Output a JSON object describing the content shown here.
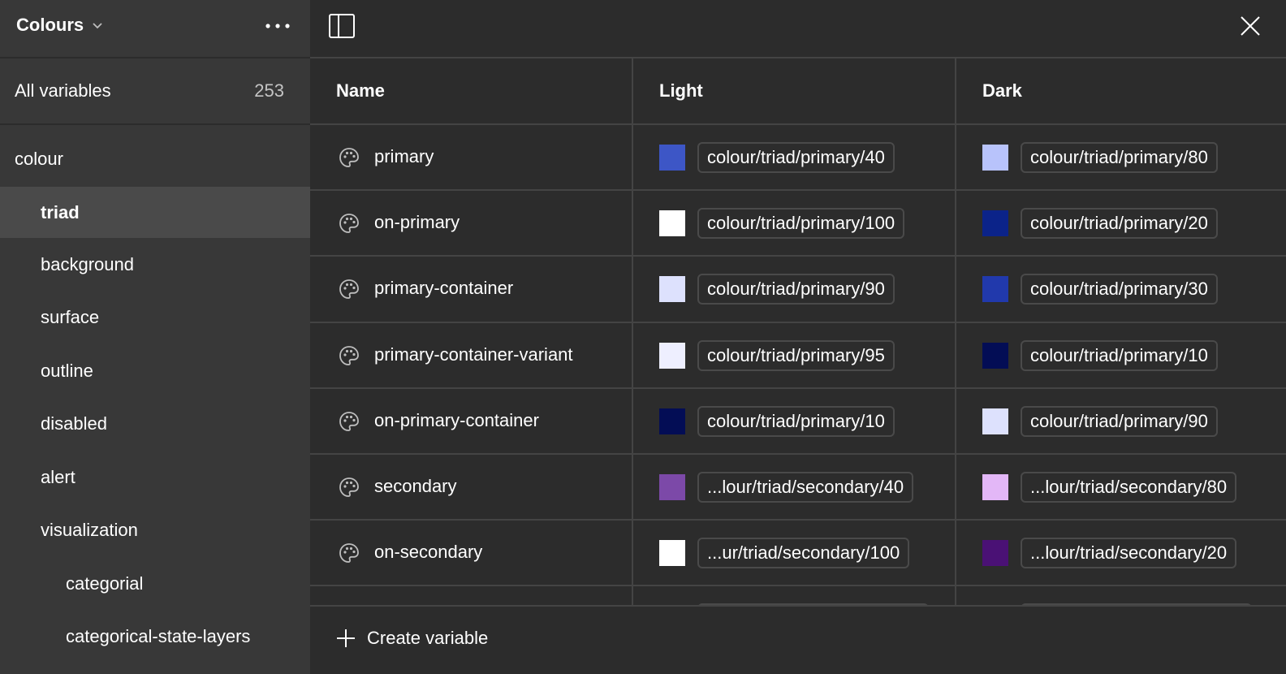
{
  "sidebar": {
    "collection_title": "Colours",
    "all_variables_label": "All variables",
    "all_variables_count": "253",
    "groups": [
      {
        "label": "colour",
        "level": 0,
        "active": false
      },
      {
        "label": "triad",
        "level": 1,
        "active": true
      },
      {
        "label": "background",
        "level": 1,
        "active": false
      },
      {
        "label": "surface",
        "level": 1,
        "active": false
      },
      {
        "label": "outline",
        "level": 1,
        "active": false
      },
      {
        "label": "disabled",
        "level": 1,
        "active": false
      },
      {
        "label": "alert",
        "level": 1,
        "active": false
      },
      {
        "label": "visualization",
        "level": 1,
        "active": false
      },
      {
        "label": "categorial",
        "level": 2,
        "active": false
      },
      {
        "label": "categorical-state-layers",
        "level": 2,
        "active": false
      }
    ]
  },
  "table": {
    "columns": [
      "Name",
      "Light",
      "Dark"
    ],
    "rows": [
      {
        "name": "primary",
        "light": {
          "swatch": "#3d56c6",
          "value": "colour/triad/primary/40"
        },
        "dark": {
          "swatch": "#b8c3fb",
          "value": "colour/triad/primary/80"
        }
      },
      {
        "name": "on-primary",
        "light": {
          "swatch": "#ffffff",
          "value": "colour/triad/primary/100"
        },
        "dark": {
          "swatch": "#0b2389",
          "value": "colour/triad/primary/20"
        }
      },
      {
        "name": "primary-container",
        "light": {
          "swatch": "#dde1fd",
          "value": "colour/triad/primary/90"
        },
        "dark": {
          "swatch": "#2139ac",
          "value": "colour/triad/primary/30"
        }
      },
      {
        "name": "primary-container-variant",
        "light": {
          "swatch": "#eeefff",
          "value": "colour/triad/primary/95"
        },
        "dark": {
          "swatch": "#030d55",
          "value": "colour/triad/primary/10"
        }
      },
      {
        "name": "on-primary-container",
        "light": {
          "swatch": "#030d55",
          "value": "colour/triad/primary/10"
        },
        "dark": {
          "swatch": "#dde1fd",
          "value": "colour/triad/primary/90"
        }
      },
      {
        "name": "secondary",
        "light": {
          "swatch": "#7c49a8",
          "value": "...lour/triad/secondary/40"
        },
        "dark": {
          "swatch": "#e3b7f7",
          "value": "...lour/triad/secondary/80"
        }
      },
      {
        "name": "on-secondary",
        "light": {
          "swatch": "#ffffff",
          "value": "...ur/triad/secondary/100"
        },
        "dark": {
          "swatch": "#4a1175",
          "value": "...lour/triad/secondary/20"
        }
      }
    ]
  },
  "footer": {
    "create_label": "Create variable"
  },
  "icons": {
    "dropdown": "chevron-down-icon",
    "more": "more-horizontal-icon",
    "panel": "sidebar-toggle-icon",
    "close": "close-icon",
    "variable": "palette-icon",
    "add": "plus-icon"
  },
  "colors": {
    "background": "#2c2c2c",
    "sidebar": "#383838",
    "sidebar_active": "#4a4a4a",
    "border": "#444444"
  }
}
